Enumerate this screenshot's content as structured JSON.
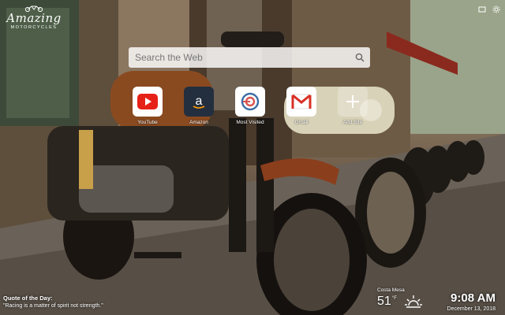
{
  "brand": {
    "name": "Amazing",
    "tagline": "MOTORCYCLES"
  },
  "search": {
    "placeholder": "Search the Web"
  },
  "tiles": [
    {
      "label": "YouTube",
      "icon": "youtube-icon",
      "color": "#ffffff"
    },
    {
      "label": "Amazon",
      "icon": "amazon-icon",
      "color": "#232f3e"
    },
    {
      "label": "Most Visited",
      "icon": "most-visited-icon",
      "color": "#ffffff"
    },
    {
      "label": "Gmail",
      "icon": "gmail-icon",
      "color": "#ffffff"
    },
    {
      "label": "Add Site",
      "icon": "add-icon",
      "color": "rgba(255,255,255,0.25)"
    }
  ],
  "quote": {
    "title": "Quote of the Day:",
    "text": "\"Racing is a matter of spirit not strength.\""
  },
  "weather": {
    "city": "Costa Mesa",
    "temp": "51",
    "unit": "°F",
    "icon": "sun-icon"
  },
  "clock": {
    "time": "9:08 AM",
    "date": "December 13, 2018"
  }
}
